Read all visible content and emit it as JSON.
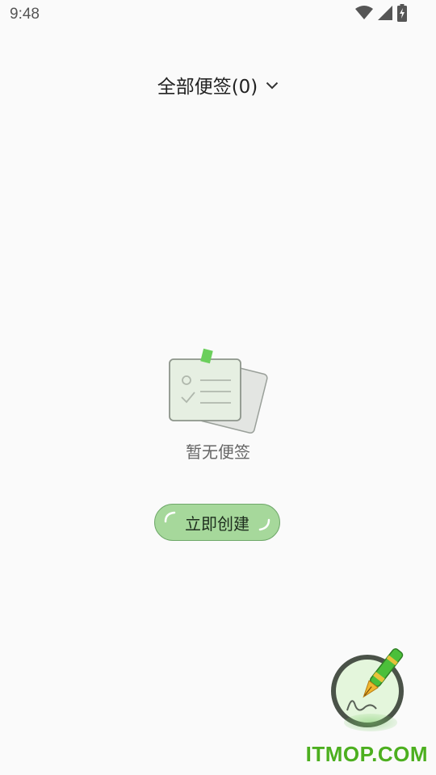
{
  "status_bar": {
    "time": "9:48",
    "icons": [
      "wifi-icon",
      "signal-icon",
      "battery-charging-icon"
    ]
  },
  "header": {
    "title": "全部便签(0)",
    "dropdown_icon": "chevron-down-icon"
  },
  "empty_state": {
    "illustration": "empty-notes-icon",
    "message": "暂无便签"
  },
  "create_button": {
    "label": "立即创建"
  },
  "fab": {
    "icon": "pen-icon"
  },
  "watermark": "ITMOP.COM",
  "colors": {
    "accent_green": "#a6d89b",
    "watermark_green": "#4caf1f",
    "background": "#fafafa"
  }
}
